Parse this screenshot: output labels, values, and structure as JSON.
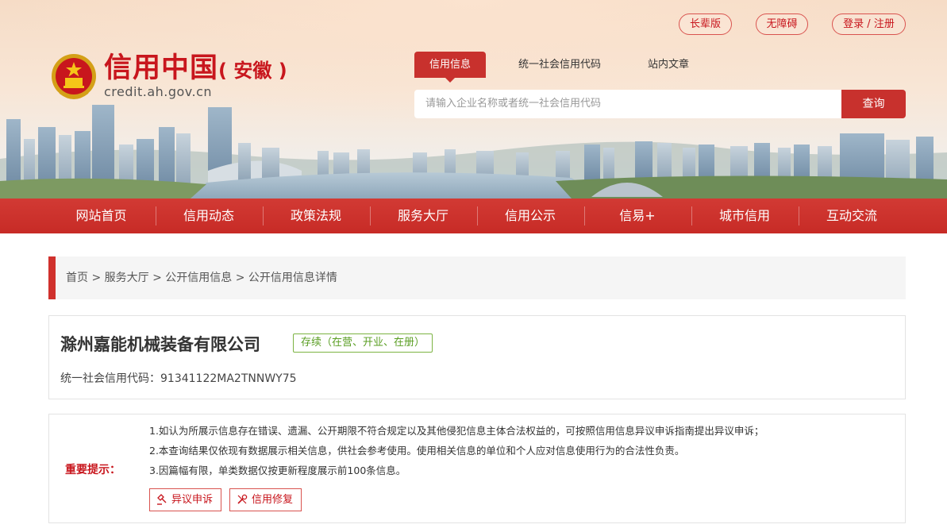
{
  "header": {
    "site_title": "信用中国",
    "site_province": "( 安徽 )",
    "site_url": "credit.ah.gov.cn",
    "top_links": [
      "长辈版",
      "无障碍",
      "登录 / 注册"
    ],
    "search_tabs": [
      "信用信息",
      "统一社会信用代码",
      "站内文章"
    ],
    "active_tab": "信用信息",
    "search_placeholder": "请输入企业名称或者统一社会信用代码",
    "search_button": "查询",
    "emblem_icon": "national-emblem-icon"
  },
  "nav": {
    "items": [
      "网站首页",
      "信用动态",
      "政策法规",
      "服务大厅",
      "信用公示",
      "信易+",
      "城市信用",
      "互动交流"
    ]
  },
  "breadcrumb": {
    "items": [
      "首页",
      "服务大厅",
      "公开信用信息",
      "公开信用信息详情"
    ],
    "text": "首页 > 服务大厅 >  公开信用信息 >  公开信用信息详情"
  },
  "company": {
    "name": "滁州嘉能机械装备有限公司",
    "status": "存续（在营、开业、在册）",
    "credit_code_label": "统一社会信用代码：",
    "credit_code": "91341122MA2TNNWY75",
    "credit_code_text": "统一社会信用代码：91341122MA2TNNWY75"
  },
  "notice": {
    "label": "重要提示：",
    "lines": [
      "1.如认为所展示信息存在错误、遗漏、公开期限不符合规定以及其他侵犯信息主体合法权益的，可按照信用信息异议申诉指南提出异议申诉；",
      "2.本查询结果仅依现有数据展示相关信息，供社会参考使用。使用相关信息的单位和个人应对信息使用行为的合法性负责。",
      "3.因篇幅有限，单类数据仅按更新程度展示前100条信息。"
    ],
    "buttons": [
      "异议申诉",
      "信用修复"
    ]
  },
  "colors": {
    "brand_red": "#c8312d",
    "status_green": "#5a9e23"
  }
}
